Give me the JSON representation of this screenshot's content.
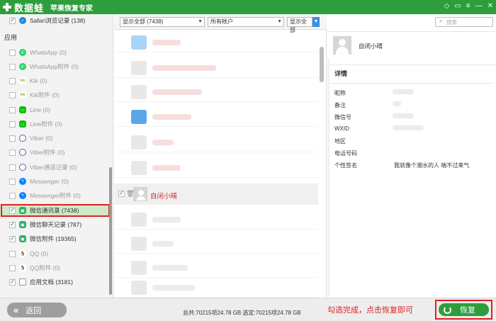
{
  "titlebar": {
    "logo_text": "数据蛙",
    "app_title": "苹果恢复专家"
  },
  "sidebar": {
    "top_item": {
      "label": "Safari浏览记录 (138)",
      "checked": true
    },
    "section": "应用",
    "items": [
      {
        "label": "WhatsApp (0)",
        "icon": "whatsapp-icon",
        "checked": false
      },
      {
        "label": "WhatsApp附件 (0)",
        "icon": "whatsapp-icon",
        "checked": false
      },
      {
        "label": "Kik (0)",
        "icon": "kik-icon",
        "checked": false
      },
      {
        "label": "Kik附件 (0)",
        "icon": "kik-icon",
        "checked": false
      },
      {
        "label": "Line (0)",
        "icon": "line-icon",
        "checked": false
      },
      {
        "label": "Line附件 (0)",
        "icon": "line-icon",
        "checked": false
      },
      {
        "label": "Viber (0)",
        "icon": "viber-icon",
        "checked": false
      },
      {
        "label": "Viber附件 (0)",
        "icon": "viber-icon",
        "checked": false
      },
      {
        "label": "Viber通话记录 (0)",
        "icon": "viber-icon",
        "checked": false
      },
      {
        "label": "Messenger (0)",
        "icon": "messenger-icon",
        "checked": false
      },
      {
        "label": "Messenger附件 (0)",
        "icon": "messenger-icon",
        "checked": false
      },
      {
        "label": "微信通讯录 (7438)",
        "icon": "wechat-icon",
        "checked": true
      },
      {
        "label": "微信聊天记录 (787)",
        "icon": "wechat-icon",
        "checked": true
      },
      {
        "label": "微信附件 (19365)",
        "icon": "wechat-icon",
        "checked": true
      },
      {
        "label": "QQ (0)",
        "icon": "qq-icon",
        "checked": false
      },
      {
        "label": "QQ附件 (0)",
        "icon": "qq-icon",
        "checked": false
      },
      {
        "label": "应用文档 (3181)",
        "icon": "document-icon",
        "checked": true
      }
    ]
  },
  "filters": {
    "show_all_count": "显示全部 (7438)",
    "account": "所有帐户",
    "show_all": "显示全部"
  },
  "search": {
    "placeholder": "搜索"
  },
  "contact": {
    "name": "自闭小晴"
  },
  "details": {
    "title": "详情",
    "fields": [
      {
        "label": "昵称"
      },
      {
        "label": "备注"
      },
      {
        "label": "微信号"
      },
      {
        "label": "WXID"
      },
      {
        "label": "地区"
      },
      {
        "label": "电话号码"
      },
      {
        "label": "个性签名",
        "value": "我就像个潮水的人 喘不过来气"
      }
    ]
  },
  "bottom": {
    "back_label": "返回",
    "totals": "总共:70215项24.78 GB 选定:70215项24.78 GB",
    "hint": "勾选完成，点击恢复即可",
    "recover_label": "恢复"
  },
  "colors": {
    "brand_green": "#2e9d3c",
    "highlight_red": "#e02020",
    "selected_name": "#d62828"
  }
}
